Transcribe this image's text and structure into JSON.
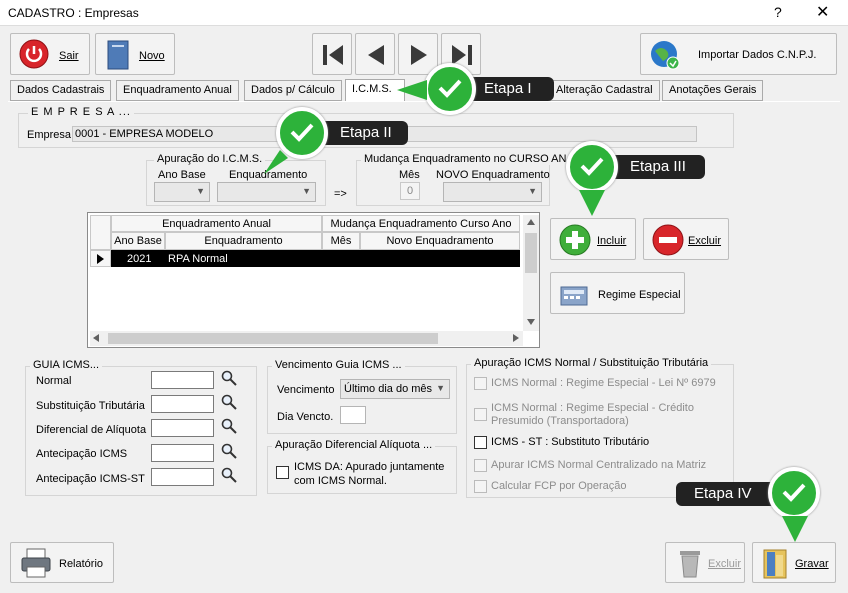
{
  "window": {
    "title": "CADASTRO : Empresas",
    "help": "?",
    "close": "✕"
  },
  "toolbar": {
    "sair": "Sair",
    "novo": "Novo",
    "importar": "Importar Dados C.N.P.J."
  },
  "tabs": [
    "Dados Cadastrais",
    "Enquadramento Anual",
    "Dados p/ Cálculo",
    "I.C.M.S.",
    "Alteração Cadastral",
    "Anotações Gerais"
  ],
  "steps": {
    "etapa1": "Etapa I",
    "etapa2": "Etapa II",
    "etapa3": "Etapa III",
    "etapa4": "Etapa IV"
  },
  "empresa": {
    "group": "E M P R E S A ...",
    "label": "Empresa",
    "value": "0001 - EMPRESA MODELO"
  },
  "apuracao": {
    "group": "Apuração do I.C.M.S.",
    "ano_base": "Ano Base",
    "enquadramento": "Enquadramento",
    "arrow": "=>"
  },
  "mudanca": {
    "group": "Mudança Enquadramento no CURSO AN",
    "mes": "Mês",
    "mes_value": "0",
    "novo": "NOVO Enquadramento"
  },
  "grid": {
    "group_left": "Enquadramento Anual",
    "group_right": "Mudança Enquadramento Curso Ano",
    "columns": [
      "Ano Base",
      "Enquadramento",
      "Mês",
      "Novo Enquadramento"
    ],
    "rows": [
      {
        "ano": "2021",
        "enquadramento": "RPA Normal",
        "mes": "",
        "novo": ""
      }
    ]
  },
  "actions": {
    "incluir": "Incluir",
    "excluir": "Excluir",
    "regime": "Regime Especial"
  },
  "guia": {
    "group": "GUIA ICMS...",
    "fields": [
      "Normal",
      "Substituição Tributária",
      "Diferencial de Alíquota",
      "Antecipação ICMS",
      "Antecipação ICMS-ST"
    ]
  },
  "vencimento": {
    "group": "Vencimento Guia ICMS ...",
    "label": "Vencimento",
    "value": "Último dia do mês",
    "dia_label": "Dia Vencto."
  },
  "diferencial": {
    "group": "Apuração Diferencial Alíquota ...",
    "option": "ICMS DA: Apurado juntamente com ICMS Normal."
  },
  "apuracao_normal": {
    "group": "Apuração ICMS Normal / Substituição Tributária",
    "options": [
      "ICMS Normal : Regime Especial - Lei Nº 6979",
      "ICMS Normal : Regime Especial - Crédito Presumido (Transportadora)",
      "ICMS - ST : Substituto Tributário",
      "Apurar ICMS Normal Centralizado na Matriz",
      "Calcular FCP por Operação"
    ]
  },
  "footer": {
    "relatorio": "Relatório",
    "excluir": "Excluir",
    "gravar": "Gravar"
  },
  "colors": {
    "accent": "#2db23a",
    "selection": "#000000"
  }
}
